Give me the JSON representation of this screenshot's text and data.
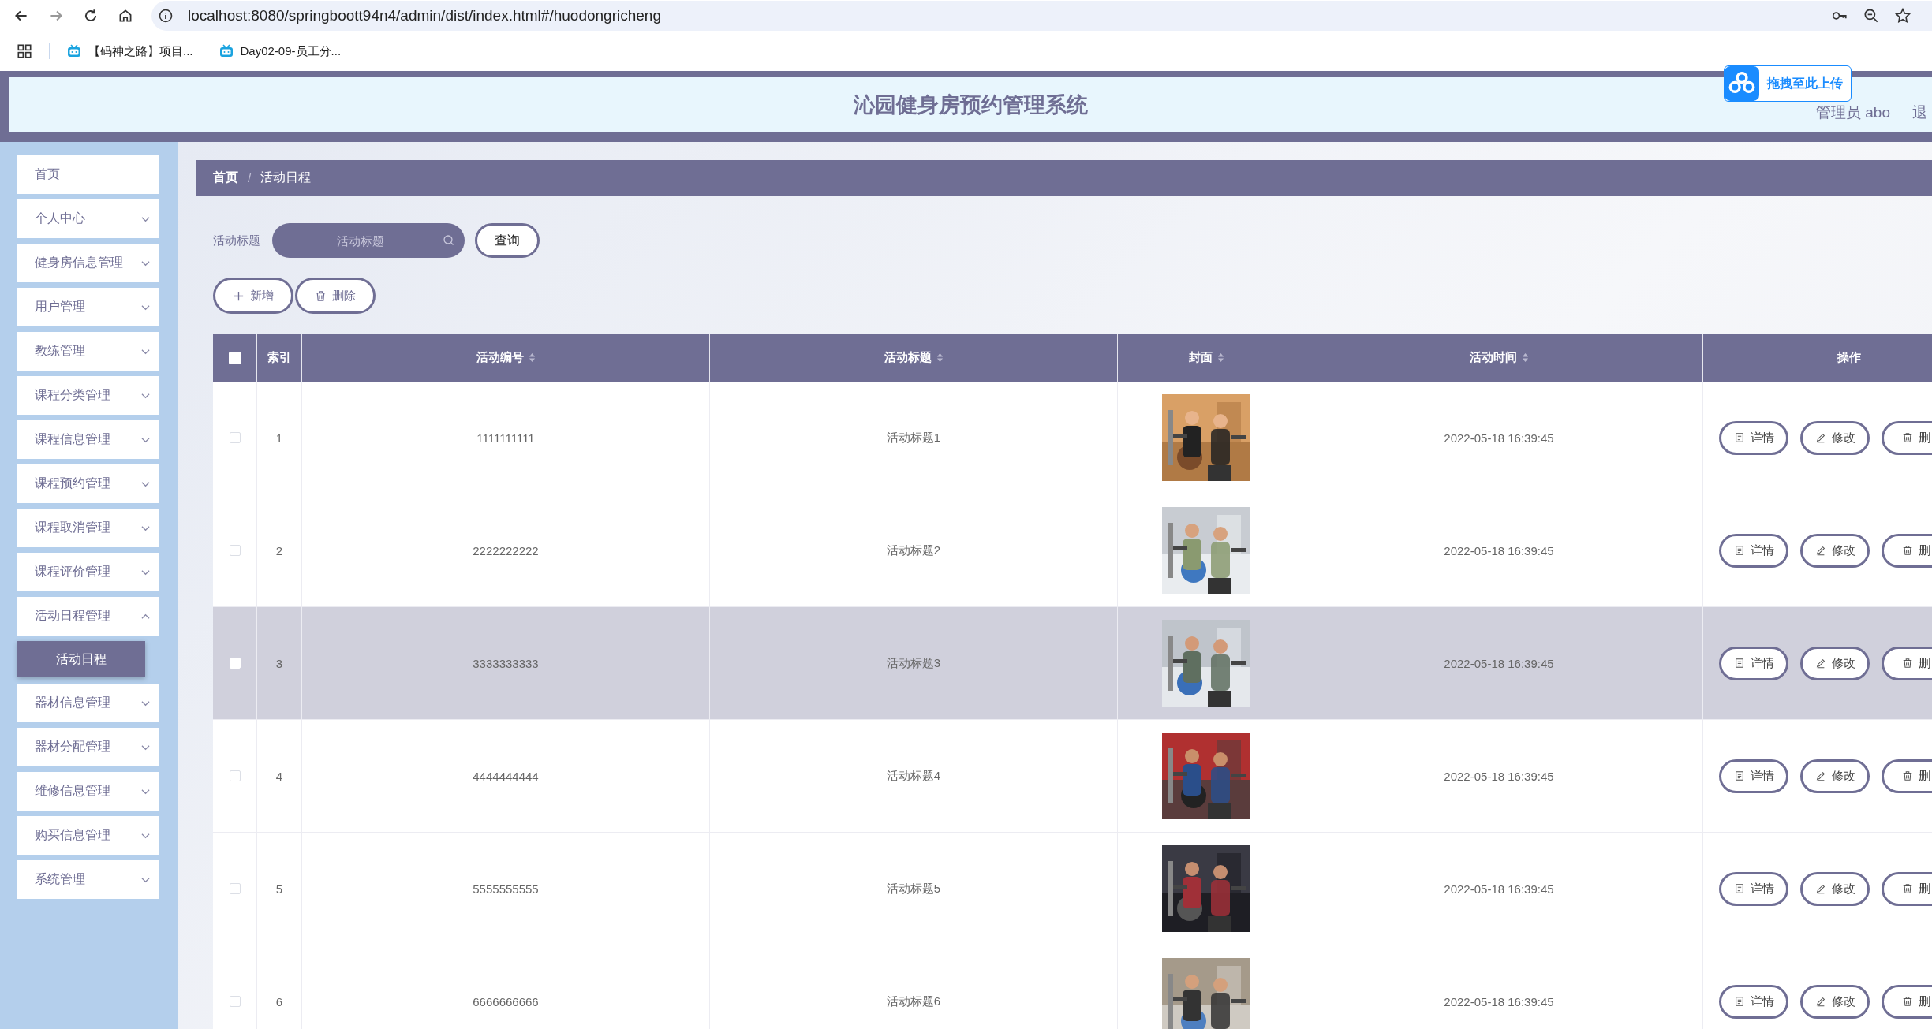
{
  "browser": {
    "url": "localhost:8080/springboott94n4/admin/dist/index.html#/huodongricheng",
    "bookmarks": [
      "【码神之路】项目...",
      "Day02-09-员工分..."
    ]
  },
  "upload_badge": "拖拽至此上传",
  "header": {
    "title": "沁园健身房预约管理系统",
    "user": "管理员 abo",
    "logout": "退"
  },
  "sidebar": {
    "items": [
      {
        "label": "首页"
      },
      {
        "label": "个人中心",
        "expanded": false
      },
      {
        "label": "健身房信息管理",
        "expanded": false
      },
      {
        "label": "用户管理",
        "expanded": false
      },
      {
        "label": "教练管理",
        "expanded": false
      },
      {
        "label": "课程分类管理",
        "expanded": false
      },
      {
        "label": "课程信息管理",
        "expanded": false
      },
      {
        "label": "课程预约管理",
        "expanded": false
      },
      {
        "label": "课程取消管理",
        "expanded": false
      },
      {
        "label": "课程评价管理",
        "expanded": false
      },
      {
        "label": "活动日程管理",
        "expanded": true,
        "children": [
          {
            "label": "活动日程",
            "selected": true
          }
        ]
      },
      {
        "label": "器材信息管理",
        "expanded": false
      },
      {
        "label": "器材分配管理",
        "expanded": false
      },
      {
        "label": "维修信息管理",
        "expanded": false
      },
      {
        "label": "购买信息管理",
        "expanded": false
      },
      {
        "label": "系统管理",
        "expanded": false
      }
    ]
  },
  "breadcrumb": {
    "items": [
      "首页",
      "活动日程"
    ],
    "separator": "/"
  },
  "search": {
    "label": "活动标题",
    "placeholder": "活动标题",
    "button": "查询"
  },
  "actions": [
    {
      "label": "新增",
      "kind": "add"
    },
    {
      "label": "删除",
      "kind": "delete"
    }
  ],
  "table": {
    "select_all_checked": false,
    "columns": [
      {
        "label": "索引",
        "sortable": false
      },
      {
        "label": "活动编号",
        "sortable": true
      },
      {
        "label": "活动标题",
        "sortable": true
      },
      {
        "label": "封面",
        "sortable": true
      },
      {
        "label": "活动时间",
        "sortable": true
      },
      {
        "label": "操作",
        "sortable": false
      }
    ],
    "rows": [
      {
        "index": "1",
        "code": "1111111111",
        "title": "活动标题1",
        "time": "2022-05-18 16:39:45",
        "checked": false,
        "selected": false,
        "actions": [
          {
            "label": "详情",
            "kind": "detail"
          },
          {
            "label": "修改",
            "kind": "edit"
          },
          {
            "label": "删",
            "kind": "delete"
          }
        ]
      },
      {
        "index": "2",
        "code": "2222222222",
        "title": "活动标题2",
        "time": "2022-05-18 16:39:45",
        "checked": false,
        "selected": false,
        "actions": [
          {
            "label": "详情",
            "kind": "detail"
          },
          {
            "label": "修改",
            "kind": "edit"
          },
          {
            "label": "删",
            "kind": "delete"
          }
        ]
      },
      {
        "index": "3",
        "code": "3333333333",
        "title": "活动标题3",
        "time": "2022-05-18 16:39:45",
        "checked": false,
        "selected": true,
        "actions": [
          {
            "label": "详情",
            "kind": "detail"
          },
          {
            "label": "修改",
            "kind": "edit"
          },
          {
            "label": "删",
            "kind": "delete"
          }
        ]
      },
      {
        "index": "4",
        "code": "4444444444",
        "title": "活动标题4",
        "time": "2022-05-18 16:39:45",
        "checked": false,
        "selected": false,
        "actions": [
          {
            "label": "详情",
            "kind": "detail"
          },
          {
            "label": "修改",
            "kind": "edit"
          },
          {
            "label": "删",
            "kind": "delete"
          }
        ]
      },
      {
        "index": "5",
        "code": "5555555555",
        "title": "活动标题5",
        "time": "2022-05-18 16:39:45",
        "checked": false,
        "selected": false,
        "actions": [
          {
            "label": "详情",
            "kind": "detail"
          },
          {
            "label": "修改",
            "kind": "edit"
          },
          {
            "label": "删",
            "kind": "delete"
          }
        ]
      },
      {
        "index": "6",
        "code": "6666666666",
        "title": "活动标题6",
        "time": "2022-05-18 16:39:45",
        "checked": false,
        "selected": false,
        "actions": [
          {
            "label": "详情",
            "kind": "detail"
          },
          {
            "label": "修改",
            "kind": "edit"
          },
          {
            "label": "删",
            "kind": "delete"
          }
        ]
      }
    ]
  }
}
